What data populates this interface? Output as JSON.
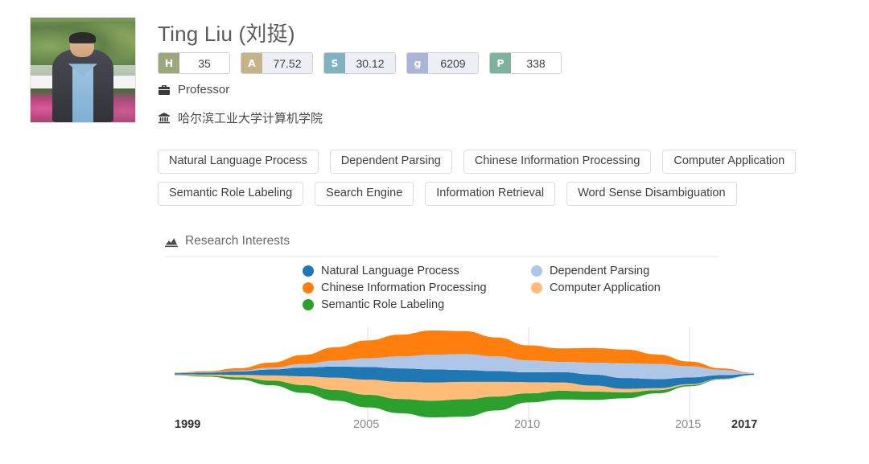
{
  "profile": {
    "name": "Ting Liu (刘挺)",
    "avatar_alt": "portrait-photo",
    "role_icon": "briefcase-icon",
    "role": "Professor",
    "org_icon": "institution-icon",
    "organization": "哈尔滨工业大学计算机学院"
  },
  "metrics": [
    {
      "key": "H",
      "value": "35",
      "key_bg": "#9aa87c",
      "tinted": false
    },
    {
      "key": "A",
      "value": "77.52",
      "key_bg": "#c3b489",
      "tinted": true
    },
    {
      "key": "S",
      "value": "30.12",
      "key_bg": "#80b2c0",
      "tinted": true
    },
    {
      "key": "g",
      "value": "6209",
      "key_bg": "#aab3d8",
      "tinted": true
    },
    {
      "key": "P",
      "value": "338",
      "key_bg": "#7fb29c",
      "tinted": false
    }
  ],
  "tags": [
    "Natural Language Process",
    "Dependent Parsing",
    "Chinese Information Processing",
    "Computer Application",
    "Semantic Role Labeling",
    "Search Engine",
    "Information Retrieval",
    "Word Sense Disambiguation"
  ],
  "section": {
    "icon": "area-chart-icon",
    "title": "Research Interests"
  },
  "chart_data": {
    "type": "area",
    "variant": "streamgraph",
    "title": "Research Interests",
    "xlabel": "",
    "ylabel": "",
    "x": [
      1999,
      2000,
      2001,
      2002,
      2003,
      2004,
      2005,
      2006,
      2007,
      2008,
      2009,
      2010,
      2011,
      2012,
      2013,
      2014,
      2015,
      2016,
      2017
    ],
    "xlim": [
      1999,
      2017
    ],
    "grid": true,
    "gridlines_at": [
      2005,
      2010,
      2015
    ],
    "legend_position": "top",
    "tick_labels": [
      {
        "label": "1999",
        "value": 1999,
        "emphasis": "strong"
      },
      {
        "label": "2005",
        "value": 2005,
        "emphasis": "normal"
      },
      {
        "label": "2010",
        "value": 2010,
        "emphasis": "normal"
      },
      {
        "label": "2015",
        "value": 2015,
        "emphasis": "normal"
      },
      {
        "label": "2017",
        "value": 2017,
        "emphasis": "strong"
      }
    ],
    "stack_order_bottom_to_top": [
      "Semantic Role Labeling",
      "Computer Application",
      "Natural Language Process",
      "Dependent Parsing",
      "Chinese Information Processing"
    ],
    "series": [
      {
        "name": "Natural Language Process",
        "color": "#1f77b4",
        "values": [
          0.6,
          1.0,
          1.8,
          3.0,
          4.4,
          5.6,
          6.4,
          6.8,
          6.6,
          6.0,
          5.4,
          5.0,
          5.2,
          5.6,
          5.4,
          4.6,
          3.4,
          1.8,
          0.5
        ]
      },
      {
        "name": "Dependent Parsing",
        "color": "#aec7e8",
        "values": [
          0.1,
          0.2,
          0.4,
          0.9,
          1.8,
          3.0,
          4.4,
          6.0,
          7.4,
          8.0,
          7.4,
          6.0,
          5.2,
          6.0,
          7.4,
          7.6,
          5.6,
          2.6,
          0.4
        ]
      },
      {
        "name": "Chinese Information Processing",
        "color": "#ff7f0e",
        "values": [
          0.2,
          0.5,
          1.2,
          2.6,
          4.6,
          6.8,
          9.0,
          11.0,
          12.2,
          11.6,
          9.6,
          7.6,
          6.8,
          7.4,
          7.0,
          4.8,
          2.4,
          0.8,
          0.1
        ]
      },
      {
        "name": "Computer Application",
        "color": "#ffbb78",
        "values": [
          0.2,
          0.5,
          1.2,
          2.6,
          4.4,
          6.2,
          7.6,
          8.6,
          9.2,
          8.8,
          7.4,
          5.6,
          4.2,
          3.0,
          1.8,
          1.0,
          0.5,
          0.2,
          0.05
        ]
      },
      {
        "name": "Semantic Role Labeling",
        "color": "#2ca02c",
        "values": [
          0.2,
          0.5,
          1.2,
          2.4,
          4.0,
          5.4,
          6.4,
          7.2,
          8.4,
          8.8,
          7.0,
          4.6,
          4.4,
          4.2,
          3.0,
          1.6,
          0.6,
          0.2,
          0.05
        ]
      }
    ]
  }
}
